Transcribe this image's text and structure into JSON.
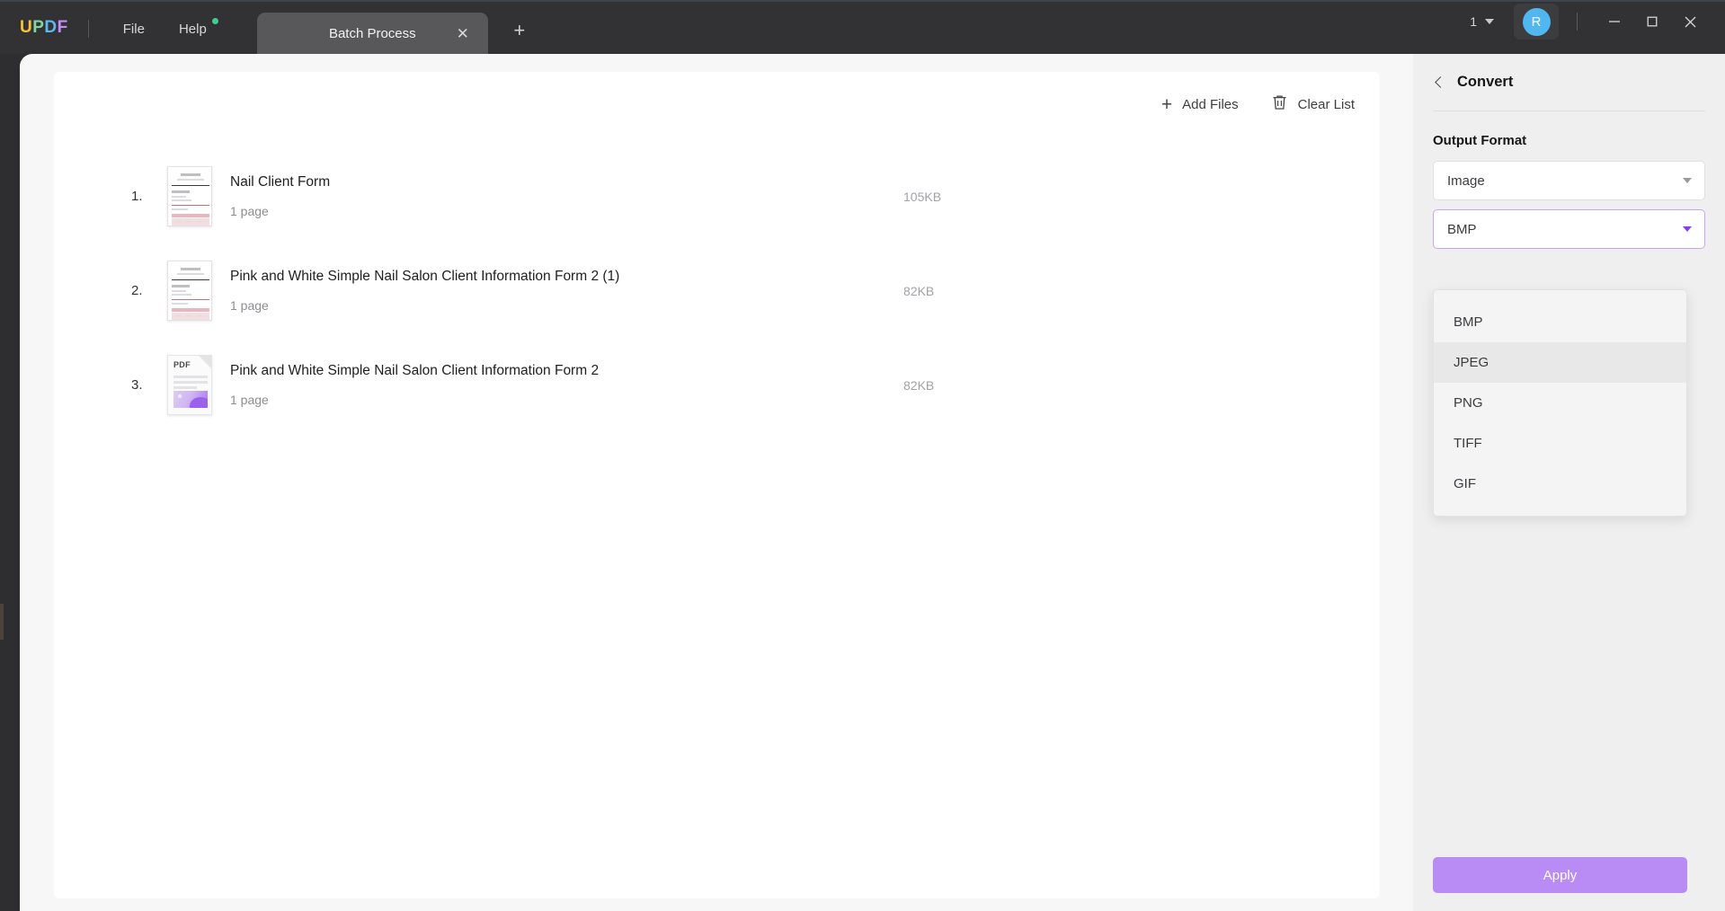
{
  "titlebar": {
    "logo_letters": [
      "U",
      "P",
      "D",
      "F"
    ],
    "menus": [
      {
        "label": "File",
        "badge": false
      },
      {
        "label": "Help",
        "badge": true
      }
    ],
    "tab": {
      "label": "Batch Process",
      "close_icon": "✕"
    },
    "add_tab_icon": "+",
    "page_count": "1",
    "avatar_initial": "R",
    "window_controls": {
      "minimize": "—",
      "maximize": "☐",
      "close": "✕"
    }
  },
  "toolbar": {
    "add_files_label": "Add Files",
    "add_files_icon": "+",
    "clear_list_label": "Clear List",
    "clear_list_icon": "trash-icon"
  },
  "files": [
    {
      "index": "1.",
      "name": "Nail Client Form",
      "pages": "1 page",
      "size": "105KB",
      "thumb_type": "document-preview"
    },
    {
      "index": "2.",
      "name": "Pink and White Simple Nail Salon Client Information Form 2 (1)",
      "pages": "1 page",
      "size": "82KB",
      "thumb_type": "document-preview"
    },
    {
      "index": "3.",
      "name": "Pink and White Simple Nail Salon Client Information Form 2",
      "pages": "1 page",
      "size": "82KB",
      "thumb_type": "pdf-generic",
      "thumb_label": "PDF"
    }
  ],
  "panel": {
    "title": "Convert",
    "back_icon": "chevron-left-icon",
    "section_label": "Output Format",
    "format_select": {
      "value": "Image"
    },
    "subformat_select": {
      "value": "BMP"
    },
    "dropdown_options": [
      {
        "label": "BMP",
        "hovered": false
      },
      {
        "label": "JPEG",
        "hovered": true
      },
      {
        "label": "PNG",
        "hovered": false
      },
      {
        "label": "TIFF",
        "hovered": false
      },
      {
        "label": "GIF",
        "hovered": false
      }
    ],
    "apply_label": "Apply"
  },
  "colors": {
    "accent_purple": "#b98cf5",
    "focus_border": "#c9a4ef",
    "titlebar_bg": "#323234",
    "avatar_blue": "#50b7f0",
    "badge_green": "#3ecf8e"
  }
}
